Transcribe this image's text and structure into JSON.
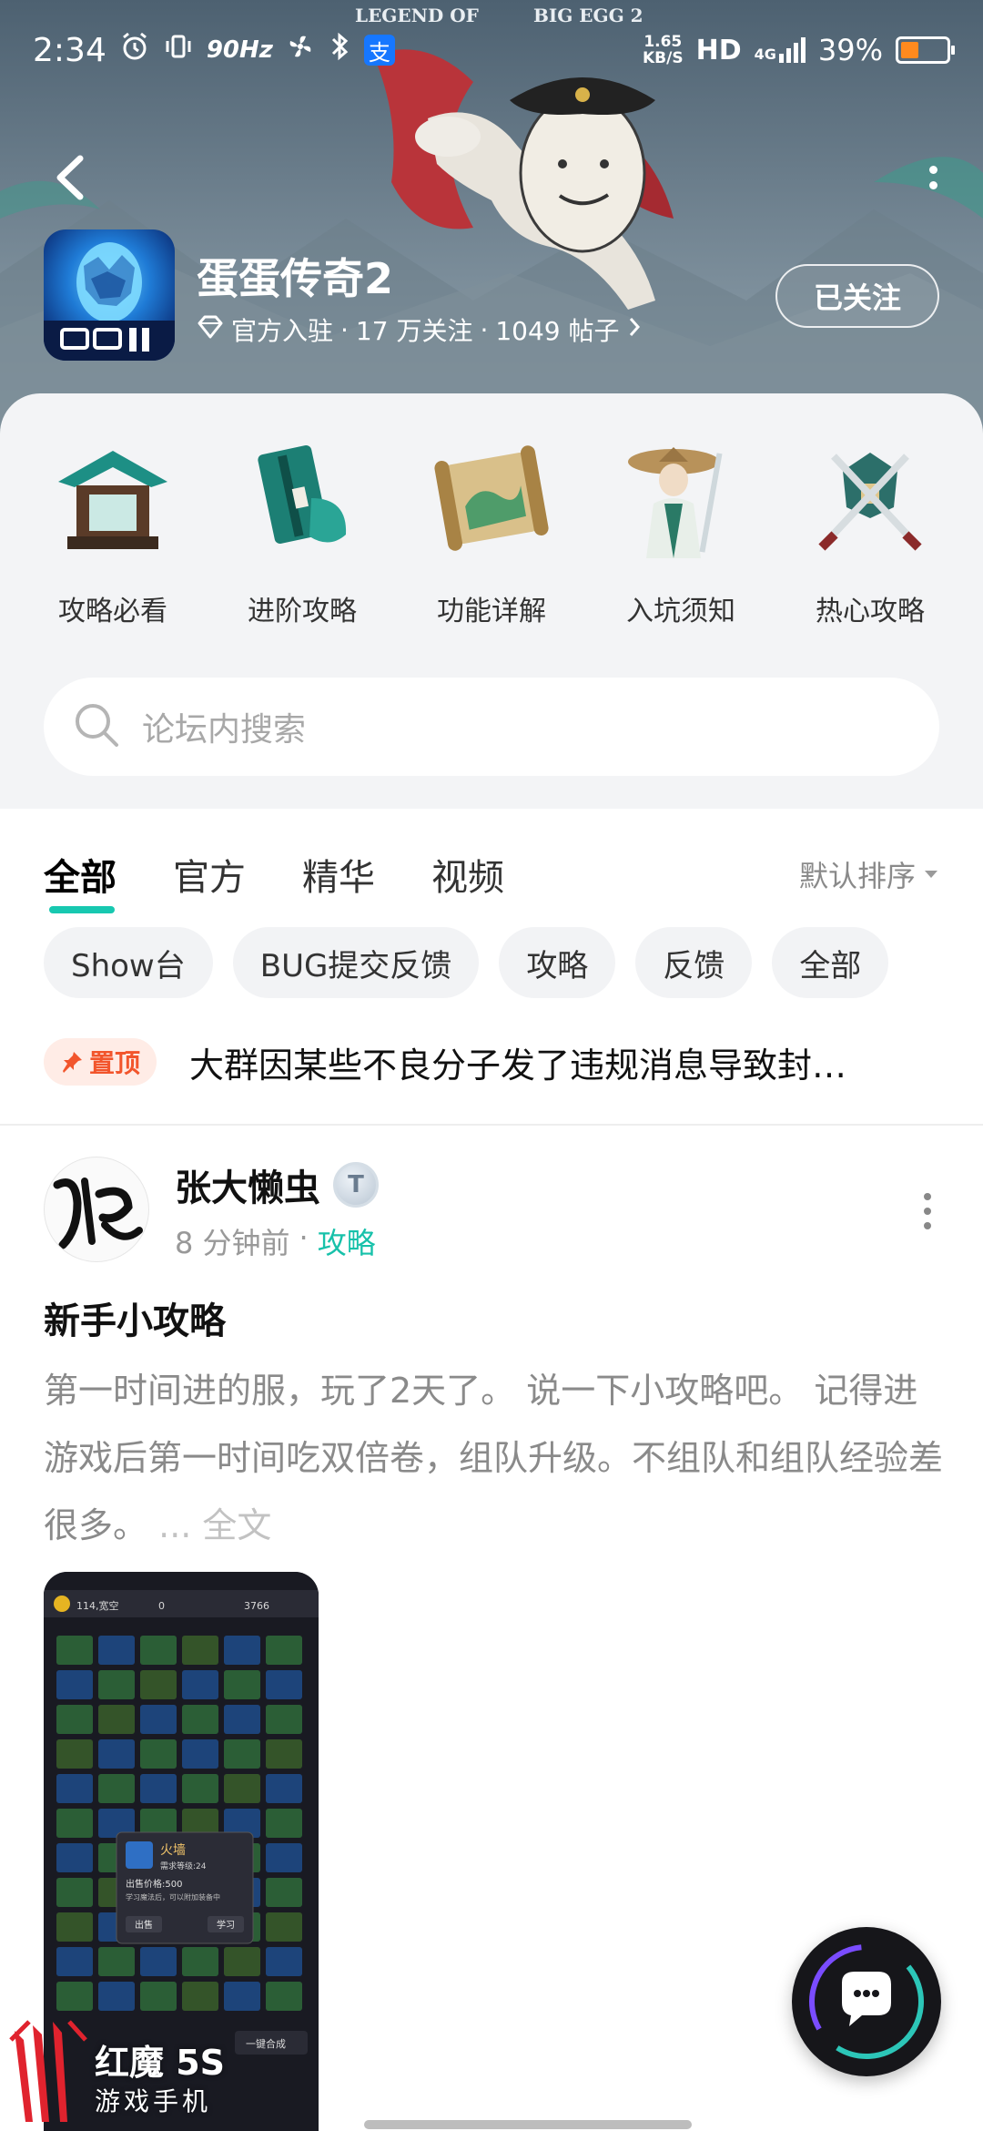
{
  "status_bar": {
    "time": "2:34",
    "refresh_rate": "90Hz",
    "net_speed_value": "1.65",
    "net_speed_unit": "KB/S",
    "hd_label": "HD",
    "network_label": "4G",
    "battery_percent": "39%",
    "battery_level": 0.39,
    "alipay_glyph": "支"
  },
  "banner": {
    "art_title_line1": "LEGEND OF",
    "art_title_line2": "BIG EGG 2"
  },
  "game": {
    "title": "蛋蛋传奇2",
    "official_label": "官方入驻",
    "followers": "17 万关注",
    "posts": "1049 帖子",
    "follow_button": "已关注"
  },
  "categories": [
    {
      "label": "攻略必看",
      "icon": "pavilion-icon"
    },
    {
      "label": "进阶攻略",
      "icon": "book-icon"
    },
    {
      "label": "功能详解",
      "icon": "scroll-icon"
    },
    {
      "label": "入坑须知",
      "icon": "swordsman-icon"
    },
    {
      "label": "热心攻略",
      "icon": "crossed-swords-icon"
    }
  ],
  "search": {
    "placeholder": "论坛内搜索"
  },
  "tabs": [
    "全部",
    "官方",
    "精华",
    "视频"
  ],
  "sort_label": "默认排序",
  "chips": [
    "Show台",
    "BUG提交反馈",
    "攻略",
    "反馈",
    "全部"
  ],
  "pinned": {
    "badge": "置顶",
    "text": "大群因某些不良分子发了违规消息导致封…"
  },
  "post": {
    "author": "张大懒虫",
    "level_badge": "T",
    "time": "8 分钟前",
    "separator": "·",
    "tag": "攻略",
    "title": "新手小攻略",
    "body": "第一时间进的服，玩了2天了。 说一下小攻略吧。 记得进游戏后第一时间吃双倍卷，组队升级。不组队和组队经验差很多。",
    "full_text_link": "... 全文",
    "image_texts": {
      "popup_title": "火墙",
      "popup_level": "需求等级:24",
      "popup_price": "出售价格:500",
      "popup_desc": "学习魔法后，可以附加装备中",
      "btn_sell": "出售",
      "btn_learn": "学习",
      "top_stat": "114,宽空",
      "top_count": "0",
      "top_value": "3766",
      "bottom_button": "一键合成"
    }
  },
  "brand_watermark": {
    "name": "红魔 5S",
    "subtitle": "游戏手机"
  },
  "colors": {
    "accent": "#17c8b0",
    "pin_red": "#f2552c",
    "battery": "#ff8a1e"
  }
}
